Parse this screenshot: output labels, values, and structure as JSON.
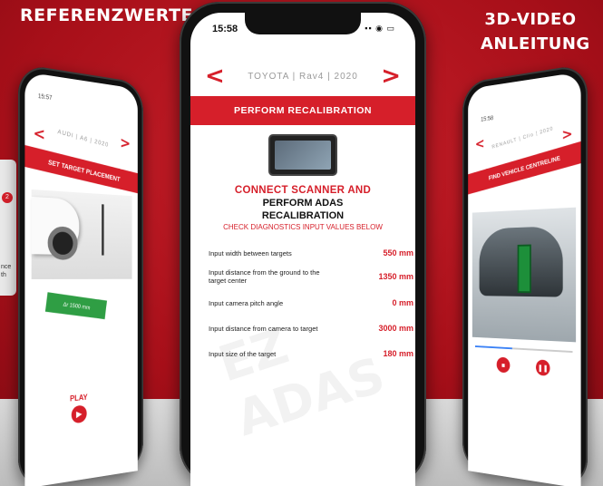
{
  "labels": {
    "left": "REFERENZWERTE",
    "right": "3D-VIDEO ANLEITUNG"
  },
  "center_phone": {
    "time": "15:58",
    "status_icons": "▪▪ ◉ ▭",
    "nav": {
      "prev": "<",
      "title": "TOYOTA | Rav4 | 2020",
      "next": ">"
    },
    "bar_title": "PERFORM RECALIBRATION",
    "heading_line1": "CONNECT SCANNER AND",
    "heading_line2": "PERFORM ADAS",
    "heading_line3": "RECALIBRATION",
    "subheading": "CHECK DIAGNOSTICS INPUT VALUES BELOW",
    "values": [
      {
        "label": "Input width between targets",
        "value": "550 mm"
      },
      {
        "label": "Input distance from the ground to the target center",
        "value": "1350 mm"
      },
      {
        "label": "Input camera pitch angle",
        "value": "0 mm"
      },
      {
        "label": "Input distance from camera to target",
        "value": "3000 mm"
      },
      {
        "label": "Input size of the target",
        "value": "180 mm"
      }
    ],
    "watermark": "EZ ADAS"
  },
  "left_phone": {
    "time": "15:57",
    "nav": {
      "prev": "<",
      "title": "AUDI | A6 | 2020",
      "next": ">"
    },
    "bar_title": "SET TARGET PLACEMENT",
    "green_label": "Δr 1500 mm",
    "play_label": "PLAY",
    "play_icon": "▶"
  },
  "side_thumb": {
    "badge": "2",
    "text": "nce th"
  },
  "right_phone": {
    "time": "15:58",
    "nav": {
      "prev": "<",
      "title": "RENAULT | Clio | 2020",
      "next": ">"
    },
    "bar_title": "FIND VEHICLE CENTRELINE",
    "stop_icon": "■",
    "pause_icon": "❚❚"
  },
  "accent_color": "#d61f2a"
}
